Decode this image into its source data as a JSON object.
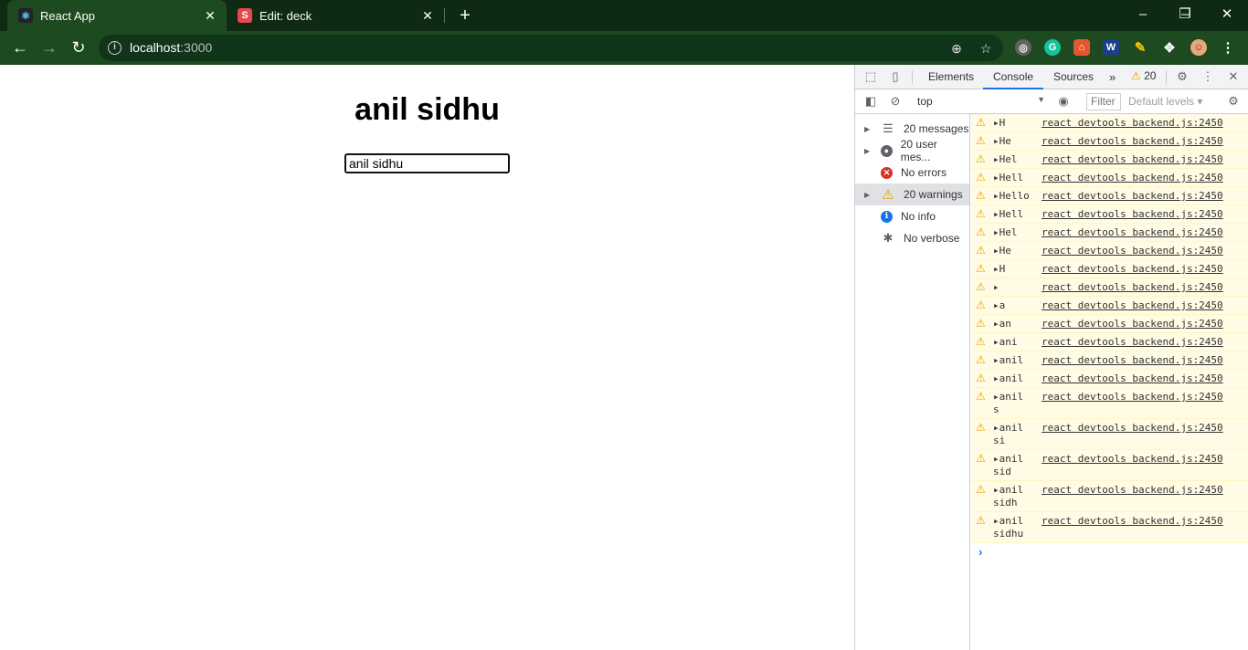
{
  "browser": {
    "tabs": [
      {
        "title": "React App",
        "favicon": "react-icon",
        "active": true
      },
      {
        "title": "Edit: deck",
        "favicon": "S",
        "active": false
      }
    ],
    "new_tab": "+",
    "window": {
      "minimize": "–",
      "restore": "❐",
      "close": "✕"
    },
    "url_host": "localhost",
    "url_port": ":3000"
  },
  "page": {
    "heading": "anil sidhu",
    "input_value": "anil sidhu"
  },
  "devtools": {
    "tabs": [
      "Elements",
      "Console",
      "Sources"
    ],
    "active_tab": "Console",
    "more": "»",
    "warning_count": "20",
    "context": "top",
    "filter_placeholder": "Filter",
    "levels": "Default levels ▾",
    "sidebar": [
      {
        "label": "20 messages",
        "icon": "list-icon",
        "expandable": true
      },
      {
        "label": "20 user mes...",
        "icon": "user-icon",
        "expandable": true
      },
      {
        "label": "No errors",
        "icon": "error-icon",
        "expandable": false
      },
      {
        "label": "20 warnings",
        "icon": "warning-icon",
        "expandable": true,
        "selected": true
      },
      {
        "label": "No info",
        "icon": "info-icon",
        "expandable": false
      },
      {
        "label": "No verbose",
        "icon": "bug-icon",
        "expandable": false
      }
    ],
    "messages": [
      {
        "text": "▸H",
        "source": "react devtools backend.js:2450"
      },
      {
        "text": "▸He",
        "source": "react devtools backend.js:2450"
      },
      {
        "text": "▸Hel",
        "source": "react devtools backend.js:2450"
      },
      {
        "text": "▸Hell",
        "source": "react devtools backend.js:2450"
      },
      {
        "text": "▸Hello",
        "source": "react devtools backend.js:2450"
      },
      {
        "text": "▸Hell",
        "source": "react devtools backend.js:2450"
      },
      {
        "text": "▸Hel",
        "source": "react devtools backend.js:2450"
      },
      {
        "text": "▸He",
        "source": "react devtools backend.js:2450"
      },
      {
        "text": "▸H",
        "source": "react devtools backend.js:2450"
      },
      {
        "text": "▸",
        "source": "react devtools backend.js:2450"
      },
      {
        "text": "▸a",
        "source": "react devtools backend.js:2450"
      },
      {
        "text": "▸an",
        "source": "react devtools backend.js:2450"
      },
      {
        "text": "▸ani",
        "source": "react devtools backend.js:2450"
      },
      {
        "text": "▸anil",
        "source": "react devtools backend.js:2450"
      },
      {
        "text": "▸anil",
        "source": "react devtools backend.js:2450"
      },
      {
        "text": "▸anil\ns",
        "source": "react devtools backend.js:2450"
      },
      {
        "text": "▸anil\nsi",
        "source": "react devtools backend.js:2450"
      },
      {
        "text": "▸anil\nsid",
        "source": "react devtools backend.js:2450"
      },
      {
        "text": "▸anil\nsidh",
        "source": "react devtools backend.js:2450"
      },
      {
        "text": "▸anil\nsidhu",
        "source": "react devtools backend.js:2450"
      }
    ],
    "prompt": "›"
  },
  "colors": {
    "chrome_frame": "#0f2a12",
    "toolbar": "#1d4a20",
    "warning_bg": "#fffbe5",
    "warning_icon": "#e2a203",
    "accent": "#1a73e8"
  }
}
